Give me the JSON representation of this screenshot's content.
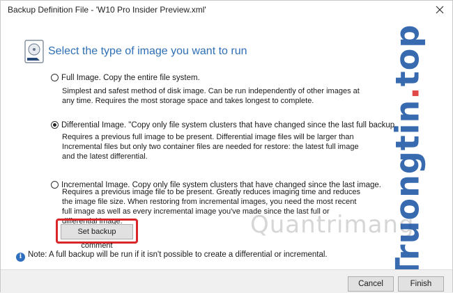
{
  "window": {
    "title": "Backup Definition File - 'W10 Pro Insider Preview.xml'",
    "close_glyph": "✕"
  },
  "heading": "Select the type of image you want to run",
  "options": [
    {
      "label": "Full Image. Copy the entire file system.",
      "checked": false,
      "description": "Simplest and safest method of disk image. Can be run independently of other images at any time. Requires the most storage space and takes longest to complete."
    },
    {
      "label": "Differential Image. \"Copy only file system clusters that have changed since the last full backup.",
      "checked": true,
      "description": "Requires a previous full image to be present. Differential image files will be larger than Incremental files but only two container files are needed for restore: the latest full image and the latest differential."
    },
    {
      "label": "Incremental Image. Copy only file system clusters that have changed since the last image.",
      "checked": false,
      "description": "Requires a previous image file to be present. Greatly reduces imaging time and reduces the image file size. When restoring from incremental images, you need the most recent full image as well as every incremental image you've made since the last full or differential image."
    }
  ],
  "comment_button": "Set backup comment",
  "note": {
    "icon_glyph": "i",
    "text": "Note:  A full backup will be run if it isn't possible to create a differential or incremental."
  },
  "footer": {
    "cancel_label": "Cancel",
    "finish_label": "Finish"
  },
  "watermark": {
    "main_text": "Truongtin",
    "dot": ".",
    "suffix": "top",
    "logo_text": "Quantrimang"
  },
  "colors": {
    "heading": "#2e6fb5",
    "highlight": "#d9262a",
    "info": "#2f6fc0"
  }
}
